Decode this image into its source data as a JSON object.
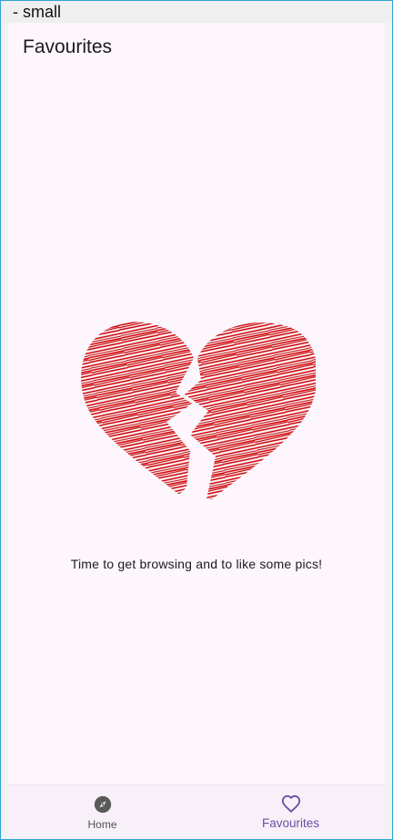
{
  "window": {
    "title": "- small"
  },
  "appbar": {
    "title": "Favourites"
  },
  "empty_state": {
    "illustration_color": "#cc0000",
    "message": "Time to get browsing and to like some pics!"
  },
  "bottom_nav": {
    "items": [
      {
        "label": "Home",
        "icon": "compass-icon",
        "active": false
      },
      {
        "label": "Favourites",
        "icon": "heart-outline-icon",
        "active": true
      }
    ],
    "active_color": "#6a4fa3"
  }
}
